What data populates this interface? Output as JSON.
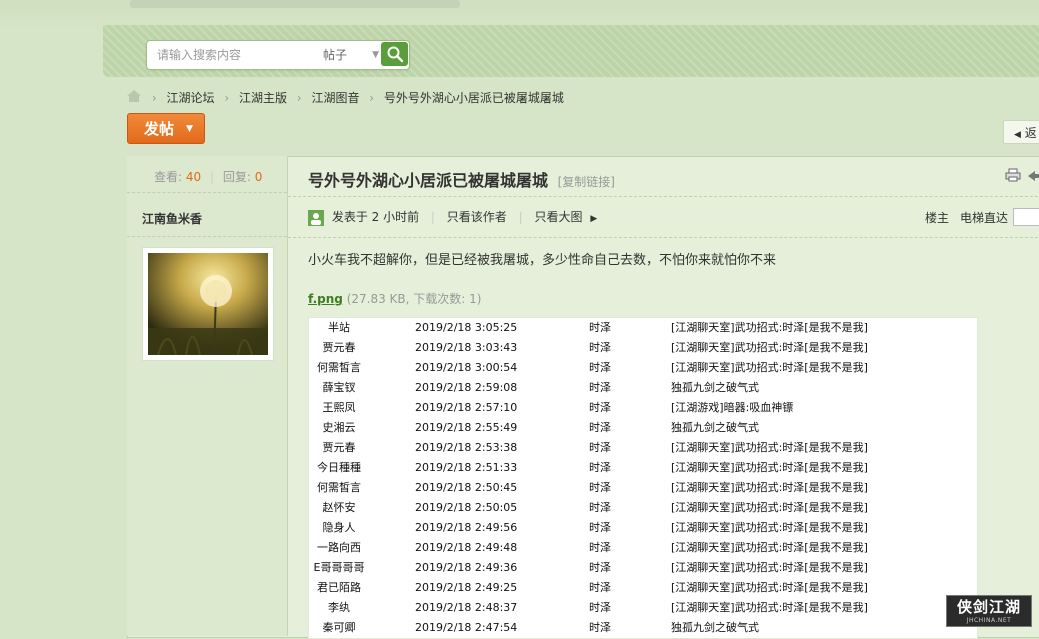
{
  "search": {
    "placeholder": "请输入搜索内容",
    "type_label": "帖子"
  },
  "breadcrumb": [
    "江湖论坛",
    "江湖主版",
    "江湖图音",
    "号外号外湖心小居派已被屠城屠城"
  ],
  "toolbar": {
    "post_label": "发帖",
    "back_label": "返"
  },
  "sidebar": {
    "views_label": "查看:",
    "views": "40",
    "replies_label": "回复:",
    "replies": "0",
    "author": "江南鱼米香"
  },
  "thread": {
    "title": "号外号外湖心小居派已被屠城屠城",
    "copy_link": "[复制链接]",
    "posted": "发表于 2 小时前",
    "only_author": "只看该作者",
    "only_images": "只看大图",
    "floor": "楼主",
    "elevator": "电梯直达",
    "content": "小火车我不超解你，但是已经被我屠城，多少性命自己去数，不怕你来就怕你不来"
  },
  "attachment": {
    "name": "f.png",
    "info": "(27.83 KB, 下载次数: 1)"
  },
  "log": [
    {
      "name": "半站",
      "time": "2019/2/18 3:05:25",
      "who": "时泽",
      "action": "[江湖聊天室]武功招式:时泽[是我不是我]"
    },
    {
      "name": "贾元春",
      "time": "2019/2/18 3:03:43",
      "who": "时泽",
      "action": "[江湖聊天室]武功招式:时泽[是我不是我]"
    },
    {
      "name": "何需皙言",
      "time": "2019/2/18 3:00:54",
      "who": "时泽",
      "action": "[江湖聊天室]武功招式:时泽[是我不是我]"
    },
    {
      "name": "薛宝钗",
      "time": "2019/2/18 2:59:08",
      "who": "时泽",
      "action": "独孤九剑之破气式"
    },
    {
      "name": "王熙凤",
      "time": "2019/2/18 2:57:10",
      "who": "时泽",
      "action": "[江湖游戏]暗器:吸血神镖"
    },
    {
      "name": "史湘云",
      "time": "2019/2/18 2:55:49",
      "who": "时泽",
      "action": "独孤九剑之破气式"
    },
    {
      "name": "贾元春",
      "time": "2019/2/18 2:53:38",
      "who": "时泽",
      "action": "[江湖聊天室]武功招式:时泽[是我不是我]"
    },
    {
      "name": "今日種種",
      "time": "2019/2/18 2:51:33",
      "who": "时泽",
      "action": "[江湖聊天室]武功招式:时泽[是我不是我]"
    },
    {
      "name": "何需皙言",
      "time": "2019/2/18 2:50:45",
      "who": "时泽",
      "action": "[江湖聊天室]武功招式:时泽[是我不是我]"
    },
    {
      "name": "赵怀安",
      "time": "2019/2/18 2:50:05",
      "who": "时泽",
      "action": "[江湖聊天室]武功招式:时泽[是我不是我]"
    },
    {
      "name": "隐身人",
      "time": "2019/2/18 2:49:56",
      "who": "时泽",
      "action": "[江湖聊天室]武功招式:时泽[是我不是我]"
    },
    {
      "name": "一路向西",
      "time": "2019/2/18 2:49:48",
      "who": "时泽",
      "action": "[江湖聊天室]武功招式:时泽[是我不是我]"
    },
    {
      "name": "E哥哥哥哥",
      "time": "2019/2/18 2:49:36",
      "who": "时泽",
      "action": "[江湖聊天室]武功招式:时泽[是我不是我]"
    },
    {
      "name": "君已陌路",
      "time": "2019/2/18 2:49:25",
      "who": "时泽",
      "action": "[江湖聊天室]武功招式:时泽[是我不是我]"
    },
    {
      "name": "李纨",
      "time": "2019/2/18 2:48:37",
      "who": "时泽",
      "action": "[江湖聊天室]武功招式:时泽[是我不是我]"
    },
    {
      "name": "秦可卿",
      "time": "2019/2/18 2:47:54",
      "who": "时泽",
      "action": "独孤九剑之破气式"
    }
  ],
  "logo": {
    "cn": "侠剑江湖",
    "en": "JHCHINA.NET"
  },
  "colors": {
    "accent": "#e26a1b",
    "link_green": "#3d7f1f",
    "search_button": "#5a9e3c",
    "page_bg": "#d6e5c7"
  },
  "icons": [
    "search-icon",
    "home-icon",
    "chevron-down-icon",
    "print-icon",
    "arrow-left-icon",
    "user-icon",
    "triangle-right-icon"
  ]
}
